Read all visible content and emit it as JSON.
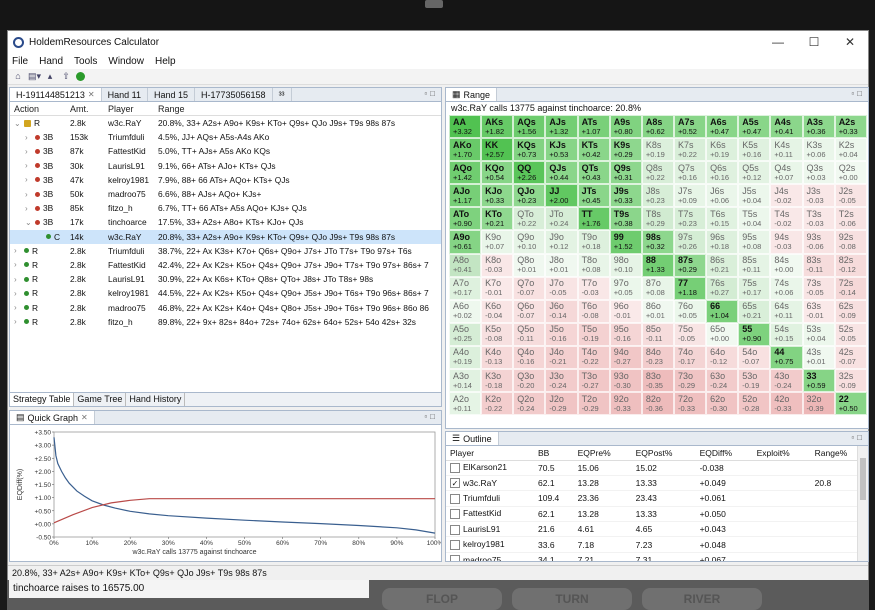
{
  "app": {
    "title": "HoldemResources Calculator"
  },
  "menu": [
    "File",
    "Hand",
    "Tools",
    "Window",
    "Help"
  ],
  "hand_tabs": [
    "H-191144851213",
    "Hand 11",
    "Hand 15",
    "H-17735056158",
    "³³"
  ],
  "strategy": {
    "headers": {
      "action": "Action",
      "amt": "Amt.",
      "player": "Player",
      "range": "Range"
    },
    "rows": [
      {
        "chev": "⌄",
        "dot": "lock",
        "action": "R",
        "amt": "2.8k",
        "player": "w3c.RaY",
        "range": "20.8%, 33+ A2s+ A9o+ K9s+ KTo+ Q9s+ QJo J9s+ T9s 98s 87s",
        "indent": 0
      },
      {
        "chev": "›",
        "dot": "red",
        "action": "3B",
        "amt": "153k",
        "player": "Triumfduli",
        "range": "4.5%, JJ+ AQs+ A5s-A4s AKo",
        "indent": 1
      },
      {
        "chev": "›",
        "dot": "red",
        "action": "3B",
        "amt": "87k",
        "player": "FattestKid",
        "range": "5.0%, TT+ AJs+ A5s AKo KQs",
        "indent": 1
      },
      {
        "chev": "›",
        "dot": "red",
        "action": "3B",
        "amt": "30k",
        "player": "LaurisL91",
        "range": "9.1%, 66+ ATs+ AJo+ KTs+ QJs",
        "indent": 1
      },
      {
        "chev": "›",
        "dot": "red",
        "action": "3B",
        "amt": "47k",
        "player": "kelroy1981",
        "range": "7.9%, 88+ 66 ATs+ AQo+ KTs+ QJs",
        "indent": 1
      },
      {
        "chev": "›",
        "dot": "red",
        "action": "3B",
        "amt": "50k",
        "player": "madroo75",
        "range": "6.6%, 88+ AJs+ AQo+ KJs+",
        "indent": 1
      },
      {
        "chev": "›",
        "dot": "red",
        "action": "3B",
        "amt": "85k",
        "player": "fitzo_h",
        "range": "6.7%, TT+ 66 ATs+ A5s AQo+ KJs+ QJs",
        "indent": 1
      },
      {
        "chev": "⌄",
        "dot": "red",
        "action": "3B",
        "amt": "17k",
        "player": "tinchoarce",
        "range": "17.5%, 33+ A2s+ A8o+ KTs+ KJo+ QJs",
        "indent": 1
      },
      {
        "chev": "",
        "dot": "green",
        "action": "C",
        "amt": "14k",
        "player": "w3c.RaY",
        "range": "20.8%, 33+ A2s+ A9o+ K9s+ KTo+ Q9s+ QJo J9s+ T9s 98s 87s",
        "indent": 2,
        "selected": true
      },
      {
        "chev": "›",
        "dot": "green",
        "action": "R",
        "amt": "2.8k",
        "player": "Triumfduli",
        "range": "38.7%, 22+ Ax K3s+ K7o+ Q6s+ Q9o+ J7s+ JTo T7s+ T9o 97s+ T6s",
        "indent": 0
      },
      {
        "chev": "›",
        "dot": "green",
        "action": "R",
        "amt": "2.8k",
        "player": "FattestKid",
        "range": "42.4%, 22+ Ax K2s+ K5o+ Q4s+ Q9o+ J7s+ J9o+ T7s+ T9o 97s+ 86s+ 7",
        "indent": 0
      },
      {
        "chev": "›",
        "dot": "green",
        "action": "R",
        "amt": "2.8k",
        "player": "LaurisL91",
        "range": "30.9%, 22+ Ax K6s+ KTo+ Q8s+ QTo+ J8s+ JTo T8s+ 98s",
        "indent": 0
      },
      {
        "chev": "›",
        "dot": "green",
        "action": "R",
        "amt": "2.8k",
        "player": "kelroy1981",
        "range": "44.5%, 22+ Ax K2s+ K5o+ Q4s+ Q9o+ J5s+ J9o+ T6s+ T9o 96s+ 86s+ 7",
        "indent": 0
      },
      {
        "chev": "›",
        "dot": "green",
        "action": "R",
        "amt": "2.8k",
        "player": "madroo75",
        "range": "46.8%, 22+ Ax K2s+ K4o+ Q4s+ Q8o+ J5s+ J9o+ T6s+ T9o 96s+ 86o 86",
        "indent": 0
      },
      {
        "chev": "›",
        "dot": "green",
        "action": "R",
        "amt": "2.8k",
        "player": "fitzo_h",
        "range": "89.8%, 22+ 9x+ 82s+ 84o+ 72s+ 74o+ 62s+ 64o+ 52s+ 54o 42s+ 32s",
        "indent": 0
      }
    ]
  },
  "bottom_tabs": [
    "Strategy Table",
    "Game Tree",
    "Hand History"
  ],
  "range_panel": {
    "tab": "Range",
    "subtitle": "w3c.RaY calls 13775 against tinchoarce: 20.8%",
    "cells": [
      [
        "AA",
        "+3.32",
        1
      ],
      [
        "AKs",
        "+1.82",
        1
      ],
      [
        "AQs",
        "+1.56",
        1
      ],
      [
        "AJs",
        "+1.32",
        1
      ],
      [
        "ATs",
        "+1.07",
        1
      ],
      [
        "A9s",
        "+0.80",
        1
      ],
      [
        "A8s",
        "+0.62",
        1
      ],
      [
        "A7s",
        "+0.52",
        1
      ],
      [
        "A6s",
        "+0.47",
        1
      ],
      [
        "A5s",
        "+0.47",
        1
      ],
      [
        "A4s",
        "+0.41",
        1
      ],
      [
        "A3s",
        "+0.36",
        1
      ],
      [
        "A2s",
        "+0.33",
        1
      ],
      [
        "AKo",
        "+1.70",
        1
      ],
      [
        "KK",
        "+2.57",
        1
      ],
      [
        "KQs",
        "+0.73",
        1
      ],
      [
        "KJs",
        "+0.53",
        1
      ],
      [
        "KTs",
        "+0.42",
        1
      ],
      [
        "K9s",
        "+0.29",
        1
      ],
      [
        "K8s",
        "+0.19",
        0
      ],
      [
        "K7s",
        "+0.22",
        0
      ],
      [
        "K6s",
        "+0.19",
        0
      ],
      [
        "K5s",
        "+0.16",
        0
      ],
      [
        "K4s",
        "+0.11",
        0
      ],
      [
        "K3s",
        "+0.06",
        0
      ],
      [
        "K2s",
        "+0.04",
        0
      ],
      [
        "AQo",
        "+1.42",
        1
      ],
      [
        "KQo",
        "+0.54",
        1
      ],
      [
        "QQ",
        "+2.26",
        1
      ],
      [
        "QJs",
        "+0.44",
        1
      ],
      [
        "QTs",
        "+0.43",
        1
      ],
      [
        "Q9s",
        "+0.31",
        1
      ],
      [
        "Q8s",
        "+0.22",
        0
      ],
      [
        "Q7s",
        "+0.16",
        0
      ],
      [
        "Q6s",
        "+0.16",
        0
      ],
      [
        "Q5s",
        "+0.12",
        0
      ],
      [
        "Q4s",
        "+0.07",
        0
      ],
      [
        "Q3s",
        "+0.03",
        0
      ],
      [
        "Q2s",
        "+0.00",
        0
      ],
      [
        "AJo",
        "+1.17",
        1
      ],
      [
        "KJo",
        "+0.33",
        1
      ],
      [
        "QJo",
        "+0.23",
        1
      ],
      [
        "JJ",
        "+2.00",
        1
      ],
      [
        "JTs",
        "+0.45",
        1
      ],
      [
        "J9s",
        "+0.33",
        1
      ],
      [
        "J8s",
        "+0.23",
        0
      ],
      [
        "J7s",
        "+0.09",
        0
      ],
      [
        "J6s",
        "+0.06",
        0
      ],
      [
        "J5s",
        "+0.04",
        0
      ],
      [
        "J4s",
        "-0.02",
        0
      ],
      [
        "J3s",
        "-0.03",
        0
      ],
      [
        "J2s",
        "-0.05",
        0
      ],
      [
        "ATo",
        "+0.90",
        1
      ],
      [
        "KTo",
        "+0.21",
        1
      ],
      [
        "QTo",
        "+0.22",
        0
      ],
      [
        "JTo",
        "+0.24",
        0
      ],
      [
        "TT",
        "+1.76",
        1
      ],
      [
        "T9s",
        "+0.38",
        1
      ],
      [
        "T8s",
        "+0.29",
        0
      ],
      [
        "T7s",
        "+0.23",
        0
      ],
      [
        "T6s",
        "+0.15",
        0
      ],
      [
        "T5s",
        "+0.04",
        0
      ],
      [
        "T4s",
        "-0.02",
        0
      ],
      [
        "T3s",
        "-0.03",
        0
      ],
      [
        "T2s",
        "-0.06",
        0
      ],
      [
        "A9o",
        "+0.61",
        1
      ],
      [
        "K9o",
        "+0.07",
        0
      ],
      [
        "Q9o",
        "+0.10",
        0
      ],
      [
        "J9o",
        "+0.12",
        0
      ],
      [
        "T9o",
        "+0.18",
        0
      ],
      [
        "99",
        "+1.52",
        1
      ],
      [
        "98s",
        "+0.32",
        1
      ],
      [
        "97s",
        "+0.26",
        0
      ],
      [
        "96s",
        "+0.18",
        0
      ],
      [
        "95s",
        "+0.08",
        0
      ],
      [
        "94s",
        "-0.03",
        0
      ],
      [
        "93s",
        "-0.06",
        0
      ],
      [
        "92s",
        "-0.08",
        0
      ],
      [
        "A8o",
        "+0.41",
        0
      ],
      [
        "K8o",
        "-0.03",
        0
      ],
      [
        "Q8o",
        "+0.01",
        0
      ],
      [
        "J8o",
        "+0.01",
        0
      ],
      [
        "T8o",
        "+0.08",
        0
      ],
      [
        "98o",
        "+0.10",
        0
      ],
      [
        "88",
        "+1.33",
        1
      ],
      [
        "87s",
        "+0.29",
        1
      ],
      [
        "86s",
        "+0.21",
        0
      ],
      [
        "85s",
        "+0.11",
        0
      ],
      [
        "84s",
        "+0.00",
        0
      ],
      [
        "83s",
        "-0.11",
        0
      ],
      [
        "82s",
        "-0.12",
        0
      ],
      [
        "A7o",
        "+0.17",
        0
      ],
      [
        "K7o",
        "-0.01",
        0
      ],
      [
        "Q7o",
        "-0.07",
        0
      ],
      [
        "J7o",
        "-0.05",
        0
      ],
      [
        "T7o",
        "-0.03",
        0
      ],
      [
        "97o",
        "+0.05",
        0
      ],
      [
        "87o",
        "+0.08",
        0
      ],
      [
        "77",
        "+1.18",
        1
      ],
      [
        "76s",
        "+0.27",
        0
      ],
      [
        "75s",
        "+0.17",
        0
      ],
      [
        "74s",
        "+0.06",
        0
      ],
      [
        "73s",
        "-0.05",
        0
      ],
      [
        "72s",
        "-0.14",
        0
      ],
      [
        "A6o",
        "+0.02",
        0
      ],
      [
        "K6o",
        "-0.04",
        0
      ],
      [
        "Q6o",
        "-0.07",
        0
      ],
      [
        "J6o",
        "-0.14",
        0
      ],
      [
        "T6o",
        "-0.08",
        0
      ],
      [
        "96o",
        "-0.01",
        0
      ],
      [
        "86o",
        "+0.01",
        0
      ],
      [
        "76o",
        "+0.05",
        0
      ],
      [
        "66",
        "+1.04",
        1
      ],
      [
        "65s",
        "+0.21",
        0
      ],
      [
        "64s",
        "+0.11",
        0
      ],
      [
        "63s",
        "-0.01",
        0
      ],
      [
        "62s",
        "-0.09",
        0
      ],
      [
        "A5o",
        "+0.25",
        0
      ],
      [
        "K5o",
        "-0.08",
        0
      ],
      [
        "Q5o",
        "-0.11",
        0
      ],
      [
        "J5o",
        "-0.16",
        0
      ],
      [
        "T5o",
        "-0.19",
        0
      ],
      [
        "95o",
        "-0.16",
        0
      ],
      [
        "85o",
        "-0.11",
        0
      ],
      [
        "75o",
        "-0.05",
        0
      ],
      [
        "65o",
        "+0.00",
        0
      ],
      [
        "55",
        "+0.90",
        1
      ],
      [
        "54s",
        "+0.15",
        0
      ],
      [
        "53s",
        "+0.04",
        0
      ],
      [
        "52s",
        "-0.05",
        0
      ],
      [
        "A4o",
        "+0.19",
        0
      ],
      [
        "K4o",
        "-0.13",
        0
      ],
      [
        "Q4o",
        "-0.16",
        0
      ],
      [
        "J4o",
        "-0.21",
        0
      ],
      [
        "T4o",
        "-0.22",
        0
      ],
      [
        "94o",
        "-0.27",
        0
      ],
      [
        "84o",
        "-0.23",
        0
      ],
      [
        "74o",
        "-0.17",
        0
      ],
      [
        "64o",
        "-0.12",
        0
      ],
      [
        "54o",
        "-0.07",
        0
      ],
      [
        "44",
        "+0.75",
        1
      ],
      [
        "43s",
        "+0.01",
        0
      ],
      [
        "42s",
        "-0.07",
        0
      ],
      [
        "A3o",
        "+0.14",
        0
      ],
      [
        "K3o",
        "-0.18",
        0
      ],
      [
        "Q3o",
        "-0.20",
        0
      ],
      [
        "J3o",
        "-0.24",
        0
      ],
      [
        "T3o",
        "-0.27",
        0
      ],
      [
        "93o",
        "-0.30",
        0
      ],
      [
        "83o",
        "-0.35",
        0
      ],
      [
        "73o",
        "-0.29",
        0
      ],
      [
        "63o",
        "-0.24",
        0
      ],
      [
        "53o",
        "-0.19",
        0
      ],
      [
        "43o",
        "-0.24",
        0
      ],
      [
        "33",
        "+0.59",
        1
      ],
      [
        "32s",
        "-0.09",
        0
      ],
      [
        "A2o",
        "+0.11",
        0
      ],
      [
        "K2o",
        "-0.22",
        0
      ],
      [
        "Q2o",
        "-0.24",
        0
      ],
      [
        "J2o",
        "-0.29",
        0
      ],
      [
        "T2o",
        "-0.29",
        0
      ],
      [
        "92o",
        "-0.33",
        0
      ],
      [
        "82o",
        "-0.36",
        0
      ],
      [
        "72o",
        "-0.33",
        0
      ],
      [
        "62o",
        "-0.30",
        0
      ],
      [
        "52o",
        "-0.28",
        0
      ],
      [
        "42o",
        "-0.33",
        0
      ],
      [
        "32o",
        "-0.39",
        0
      ],
      [
        "22",
        "+0.50",
        1
      ]
    ]
  },
  "quick_graph": {
    "tab": "Quick Graph",
    "chart_data": {
      "type": "line",
      "ylabel": "EQDiff(%)",
      "xlabel": "w3c.RaY calls 13775 against tinchoarce",
      "y_ticks": [
        "+3.50",
        "+3.00",
        "+2.50",
        "+2.00",
        "+1.50",
        "+1.00",
        "+0.50",
        "+0.00",
        "-0.50"
      ],
      "x_ticks": [
        "0%",
        "10%",
        "20%",
        "30%",
        "40%",
        "50%",
        "60%",
        "70%",
        "80%",
        "90%",
        "100%"
      ],
      "ylim": [
        -0.5,
        3.5
      ],
      "xlim": [
        0,
        100
      ],
      "series": [
        {
          "color": "#3a5f8f",
          "x": [
            0,
            0.5,
            1,
            2,
            3,
            4,
            5,
            6,
            8,
            10,
            13,
            16,
            20,
            25,
            30,
            40,
            50,
            60,
            70,
            80,
            90,
            95,
            100
          ],
          "y": [
            3.3,
            2.6,
            2.3,
            2.0,
            1.75,
            1.55,
            1.4,
            1.25,
            1.05,
            0.88,
            0.72,
            0.6,
            0.48,
            0.38,
            0.31,
            0.22,
            0.14,
            0.07,
            0.01,
            -0.06,
            -0.15,
            -0.23,
            -0.35
          ]
        },
        {
          "color": "#b94a48",
          "x": [
            0,
            5,
            10,
            15,
            20,
            25,
            100
          ],
          "y": [
            0.04,
            0.35,
            0.62,
            0.8,
            0.9,
            0.96,
            0.96
          ]
        }
      ]
    }
  },
  "outline": {
    "tab": "Outline",
    "headers": [
      "Player",
      "BB",
      "EQPre%",
      "EQPost%",
      "EQDiff%",
      "Exploit%",
      "Range%"
    ],
    "rows": [
      {
        "player": "ElKarson21",
        "bb": "70.5",
        "pre": "15.06",
        "post": "15.02",
        "diff": "-0.038",
        "exploit": "",
        "range": "",
        "checked": false
      },
      {
        "player": "w3c.RaY",
        "bb": "62.1",
        "pre": "13.28",
        "post": "13.33",
        "diff": "+0.049",
        "exploit": "",
        "range": "20.8",
        "checked": true
      },
      {
        "player": "Triumfduli",
        "bb": "109.4",
        "pre": "23.36",
        "post": "23.43",
        "diff": "+0.061",
        "exploit": "",
        "range": "",
        "checked": false
      },
      {
        "player": "FattestKid",
        "bb": "62.1",
        "pre": "13.28",
        "post": "13.33",
        "diff": "+0.050",
        "exploit": "",
        "range": "",
        "checked": false
      },
      {
        "player": "LaurisL91",
        "bb": "21.6",
        "pre": "4.61",
        "post": "4.65",
        "diff": "+0.043",
        "exploit": "",
        "range": "",
        "checked": false
      },
      {
        "player": "kelroy1981",
        "bb": "33.6",
        "pre": "7.18",
        "post": "7.23",
        "diff": "+0.048",
        "exploit": "",
        "range": "",
        "checked": false
      },
      {
        "player": "madroo75",
        "bb": "34.1",
        "pre": "7.21",
        "post": "7.31",
        "diff": "+0.067",
        "exploit": "",
        "range": "",
        "checked": false
      }
    ]
  },
  "statusbar": "20.8%, 33+ A2s+ A9o+ K9s+ KTo+ Q9s+ QJo J9s+ T9s 98s 87s",
  "below": {
    "message": "tinchoarce raises to 16575.00",
    "buttons": [
      "FLOP",
      "TURN",
      "RIVER"
    ]
  }
}
